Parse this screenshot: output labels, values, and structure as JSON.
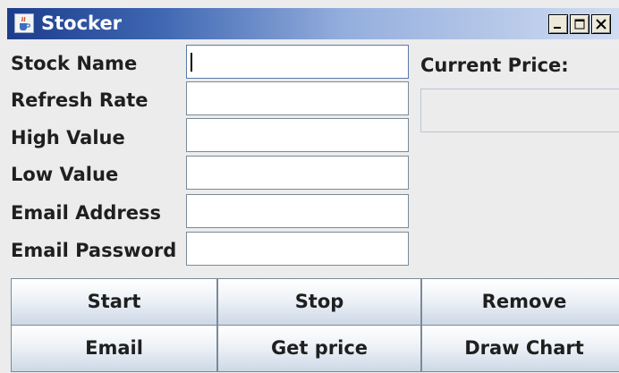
{
  "window": {
    "title": "Stocker",
    "icon": "java-cup-icon"
  },
  "fields": [
    {
      "label": "Stock Name",
      "value": ""
    },
    {
      "label": "Refresh Rate",
      "value": ""
    },
    {
      "label": "High Value",
      "value": ""
    },
    {
      "label": "Low Value",
      "value": ""
    },
    {
      "label": "Email Address",
      "value": ""
    },
    {
      "label": "Email Password",
      "value": ""
    }
  ],
  "price": {
    "label": "Current Price:",
    "value": ""
  },
  "buttons": {
    "start": "Start",
    "stop": "Stop",
    "remove": "Remove",
    "email": "Email",
    "get_price": "Get price",
    "draw_chart": "Draw Chart"
  },
  "colors": {
    "titlebar_start": "#1c3d8c",
    "titlebar_end": "#d0dcf1",
    "background": "#ececec"
  }
}
